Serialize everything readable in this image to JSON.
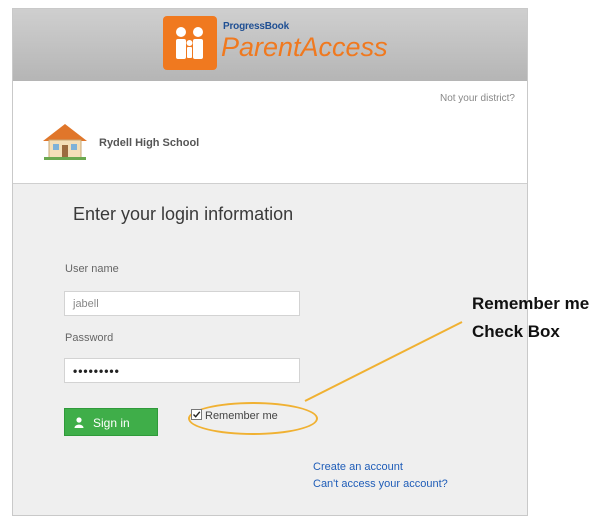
{
  "header": {
    "brand_small": "ProgressBook",
    "brand_big": "ParentAccess",
    "logo_icon": "family-icon"
  },
  "district": {
    "not_your_district": "Not your district?",
    "school_name": "Rydell High School",
    "school_icon": "school-house-icon"
  },
  "login": {
    "heading": "Enter your login information",
    "username_label": "User name",
    "username_value": "jabell",
    "password_label": "Password",
    "password_value": "•••••••••",
    "sign_in_label": "Sign in",
    "sign_in_icon": "user-icon",
    "remember_me_label": "Remember me",
    "remember_me_checked": true
  },
  "links": {
    "create_account": "Create an account",
    "cant_access": "Can't access your account?"
  },
  "annotation": {
    "line1": "Remember me",
    "line2": "Check Box",
    "highlight_color": "#f0b132"
  },
  "colors": {
    "brand_orange": "#f0791f",
    "brand_blue": "#1f4f93",
    "sign_in_green": "#3fae49",
    "link_blue": "#1f5db8"
  }
}
